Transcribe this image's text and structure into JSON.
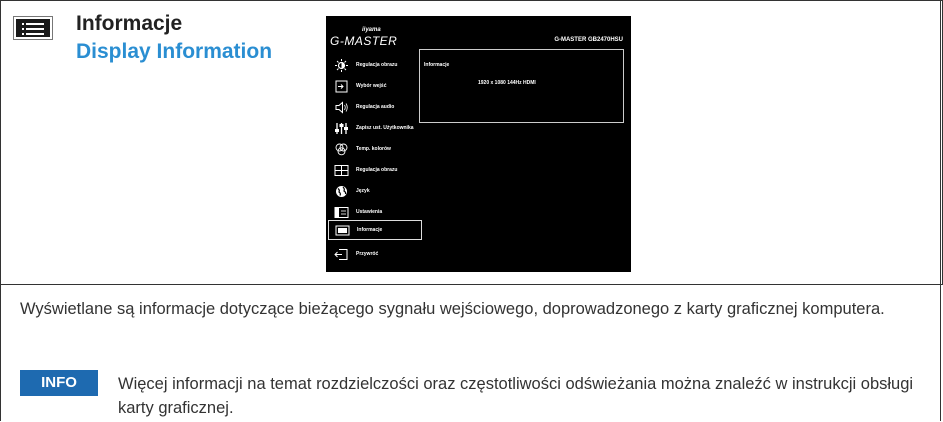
{
  "header": {
    "title_pl": "Informacje",
    "title_en": "Display Information",
    "icon": "menu-list-icon"
  },
  "osd": {
    "brand": "iiyama",
    "series": "G-MASTER",
    "model": "G-MASTER GB2470HSU",
    "menu": [
      {
        "label": "Regulacja obrazu",
        "icon": "brightness-icon",
        "selected": false
      },
      {
        "label": "Wybór wejść",
        "icon": "input-icon",
        "selected": false
      },
      {
        "label": "Regulacja audio",
        "icon": "speaker-icon",
        "selected": false
      },
      {
        "label": "Zapisz ust. Użytkownika",
        "icon": "sliders-icon",
        "selected": false
      },
      {
        "label": "Temp. kolorów",
        "icon": "color-temp-icon",
        "selected": false
      },
      {
        "label": "Regulacja obrazu",
        "icon": "picture-adjust-icon",
        "selected": false
      },
      {
        "label": "Język",
        "icon": "globe-icon",
        "selected": false
      },
      {
        "label": "Ustawienia",
        "icon": "settings-icon",
        "selected": false
      },
      {
        "label": "Informacje",
        "icon": "info-icon",
        "selected": true
      },
      {
        "label": "Przywróć",
        "icon": "reset-icon",
        "selected": false
      }
    ],
    "info_panel": {
      "title": "Informacje",
      "value": "1920 x 1080  144Hz      HDMI"
    }
  },
  "description": "Wyświetlane są informacje dotyczące bieżącego sygnału wejściowego, doprowadzonego z karty graficznej komputera.",
  "info_note": {
    "badge": "INFO",
    "text": "Więcej informacji na temat rozdzielczości oraz częstotliwości odświeżania można znaleźć w instrukcji obsługi karty graficznej."
  },
  "colors": {
    "accent_blue": "#2a8ed2",
    "badge_blue": "#1e6ab0"
  }
}
